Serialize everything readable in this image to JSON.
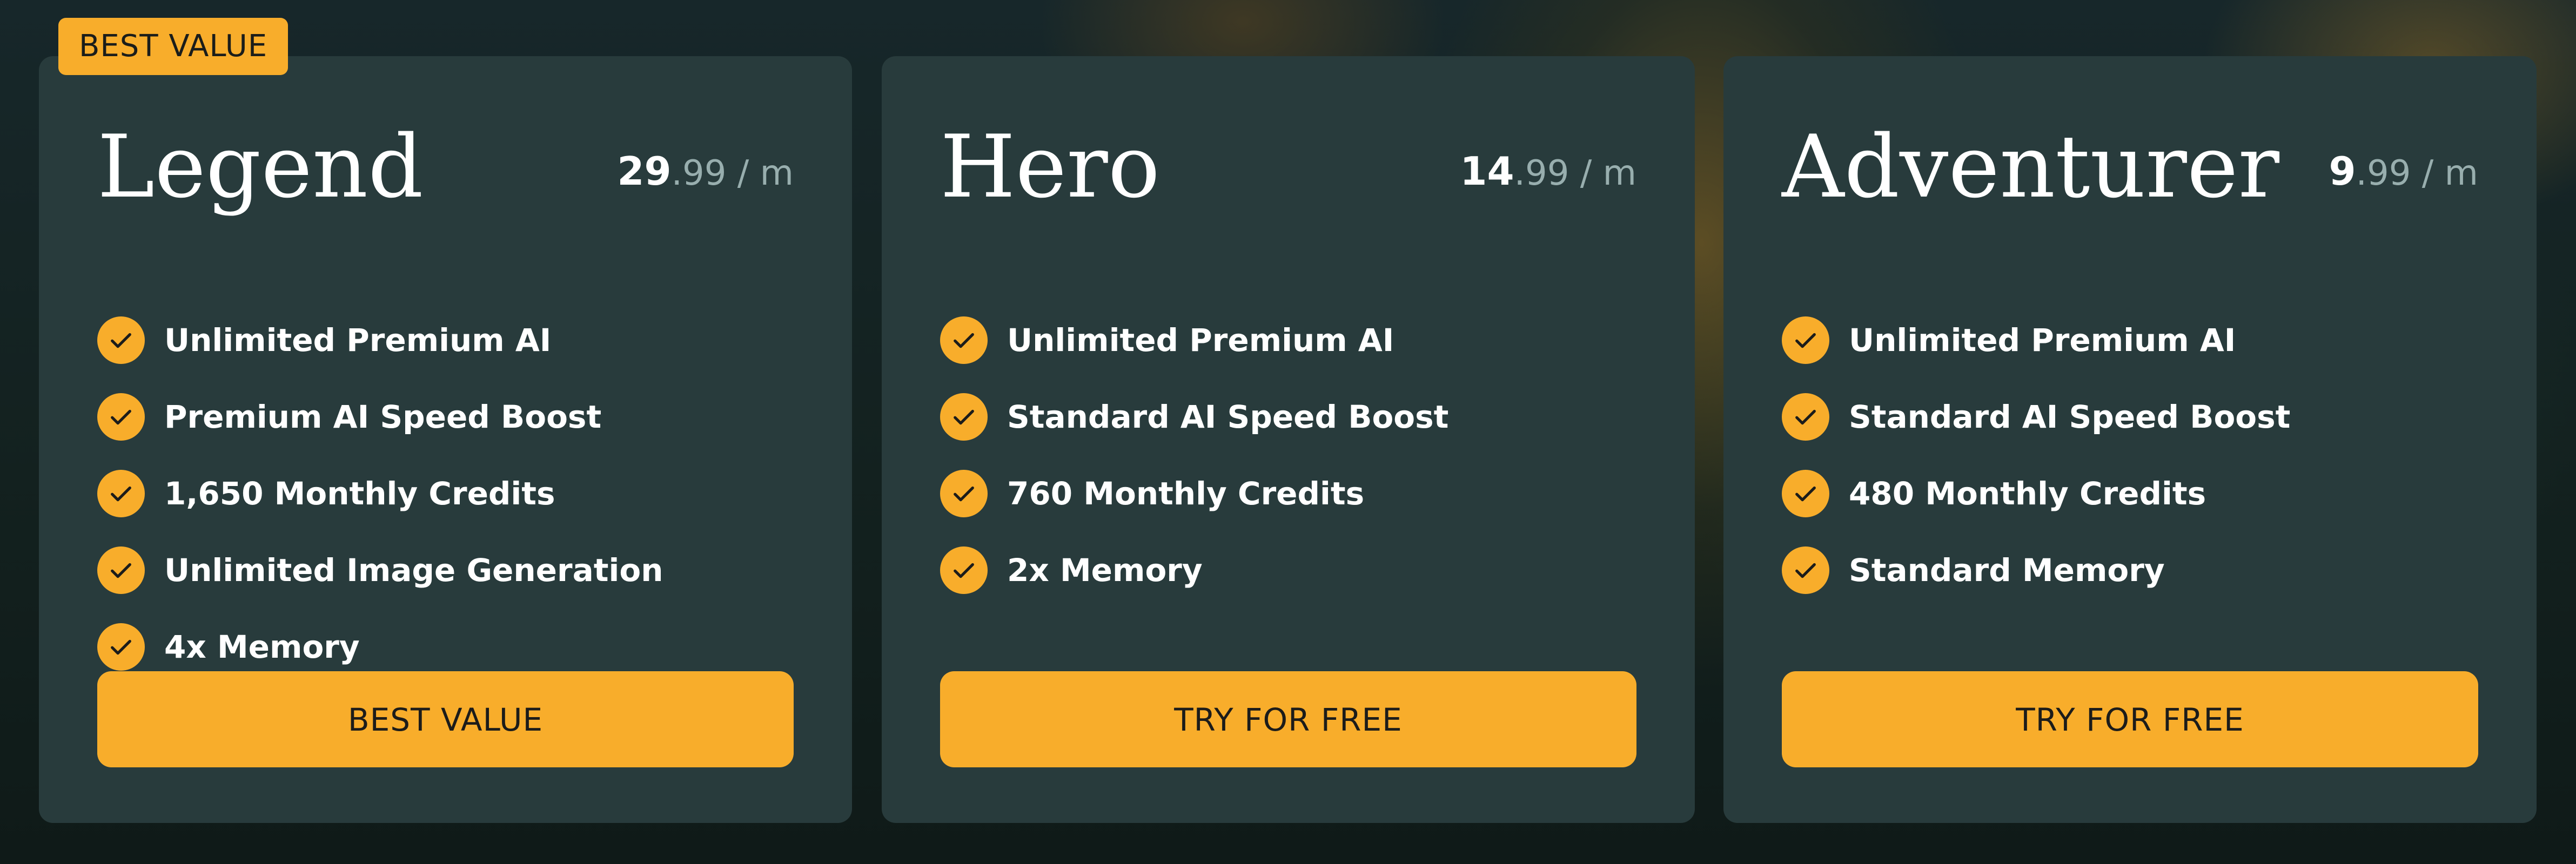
{
  "colors": {
    "accent": "#f8ad2b",
    "card_bg": "#283b3c",
    "page_bg": "#13201f",
    "price_muted": "#98aeae",
    "text": "#ffffff"
  },
  "check_icon": "check-circle-icon",
  "plans": [
    {
      "badge": "BEST VALUE",
      "name": "Legend",
      "price_whole": "29",
      "price_rest": ".99 / m",
      "features": [
        "Unlimited Premium AI",
        "Premium AI Speed Boost",
        "1,650 Monthly Credits",
        "Unlimited Image Generation",
        "4x Memory"
      ],
      "cta_label": "BEST VALUE"
    },
    {
      "name": "Hero",
      "price_whole": "14",
      "price_rest": ".99 / m",
      "features": [
        "Unlimited Premium AI",
        "Standard AI Speed Boost",
        "760 Monthly Credits",
        "2x Memory"
      ],
      "cta_label": "TRY FOR FREE"
    },
    {
      "name": "Adventurer",
      "price_whole": "9",
      "price_rest": ".99 / m",
      "features": [
        "Unlimited Premium AI",
        "Standard AI Speed Boost",
        "480 Monthly Credits",
        "Standard Memory"
      ],
      "cta_label": "TRY FOR FREE"
    }
  ]
}
